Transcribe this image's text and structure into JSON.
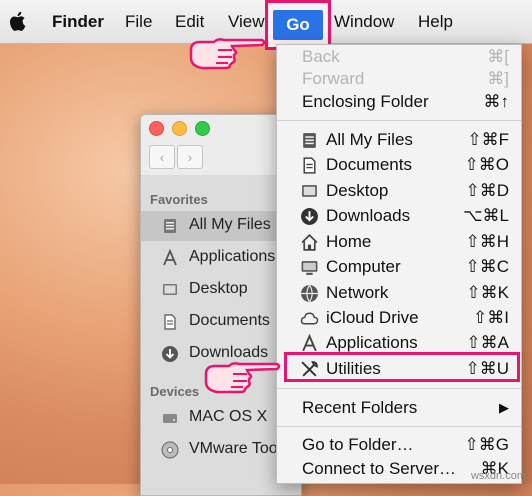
{
  "menubar": {
    "items": [
      "Finder",
      "File",
      "Edit",
      "View",
      "Go",
      "Window",
      "Help"
    ],
    "active": "Go"
  },
  "finder_window": {
    "sections": [
      {
        "heading": "Favorites",
        "items": [
          {
            "label": "All My Files",
            "icon": "all-files-icon",
            "selected": true
          },
          {
            "label": "Applications",
            "icon": "applications-icon"
          },
          {
            "label": "Desktop",
            "icon": "desktop-icon"
          },
          {
            "label": "Documents",
            "icon": "documents-icon"
          },
          {
            "label": "Downloads",
            "icon": "downloads-icon"
          }
        ]
      },
      {
        "heading": "Devices",
        "items": [
          {
            "label": "MAC OS X",
            "icon": "disk-icon"
          },
          {
            "label": "VMware Too",
            "icon": "cd-icon"
          }
        ]
      }
    ]
  },
  "go_menu": {
    "items": [
      {
        "label": "Back",
        "shortcut": "⌘[",
        "disabled": true
      },
      {
        "label": "Forward",
        "shortcut": "⌘]",
        "disabled": true
      },
      {
        "label": "Enclosing Folder",
        "shortcut": "⌘↑"
      },
      {
        "label": "All My Files",
        "shortcut": "⇧⌘F",
        "icon": "all-files-icon"
      },
      {
        "label": "Documents",
        "shortcut": "⇧⌘O",
        "icon": "documents-icon"
      },
      {
        "label": "Desktop",
        "shortcut": "⇧⌘D",
        "icon": "desktop-icon"
      },
      {
        "label": "Downloads",
        "shortcut": "⌥⌘L",
        "icon": "downloads-icon"
      },
      {
        "label": "Home",
        "shortcut": "⇧⌘H",
        "icon": "home-icon"
      },
      {
        "label": "Computer",
        "shortcut": "⇧⌘C",
        "icon": "computer-icon"
      },
      {
        "label": "Network",
        "shortcut": "⇧⌘K",
        "icon": "network-icon"
      },
      {
        "label": "iCloud Drive",
        "shortcut": "⇧⌘I",
        "icon": "cloud-icon"
      },
      {
        "label": "Applications",
        "shortcut": "⇧⌘A",
        "icon": "applications-icon"
      },
      {
        "label": "Utilities",
        "shortcut": "⇧⌘U",
        "icon": "utilities-icon",
        "highlighted": true
      },
      {
        "label": "Recent Folders",
        "shortcut": "▶"
      },
      {
        "label": "Go to Folder…",
        "shortcut": "⇧⌘G"
      },
      {
        "label": "Connect to Server…",
        "shortcut": "⌘K"
      }
    ]
  },
  "watermark": "wsxdn.com",
  "colors": {
    "highlight_border": "#e8146e",
    "go_selected": "#2a73e6"
  }
}
